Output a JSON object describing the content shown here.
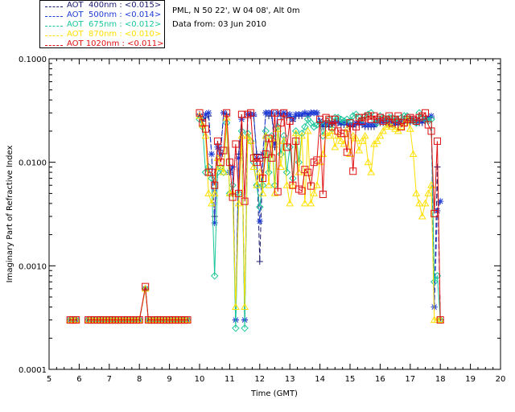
{
  "header": {
    "site": "PML, N 50 22', W 04 08', Alt 0m",
    "date": "Data from: 03 Jun 2010"
  },
  "legend": [
    {
      "label": "AOT  400nm : <0.015>",
      "color": "#1a1a6e"
    },
    {
      "label": "AOT  500nm : <0.014>",
      "color": "#1d3bd6"
    },
    {
      "label": "AOT  675nm : <0.012>",
      "color": "#19c79a"
    },
    {
      "label": "AOT  870nm : <0.010>",
      "color": "#ffe000"
    },
    {
      "label": "AOT 1020nm : <0.011>",
      "color": "#e01010"
    }
  ],
  "chart_data": {
    "type": "line",
    "xlabel": "Time (GMT)",
    "ylabel": "Imaginary Part of Refractive Index",
    "xlim": [
      5,
      20
    ],
    "ylim": [
      0.0001,
      0.1
    ],
    "yscale": "log",
    "x_ticks": [
      "5",
      "6",
      "7",
      "8",
      "9",
      "10",
      "11",
      "12",
      "13",
      "14",
      "15",
      "16",
      "17",
      "18",
      "19",
      "20"
    ],
    "y_ticks": [
      "0.0001",
      "0.0010",
      "0.0100",
      "0.1000"
    ],
    "x": [
      5.7,
      5.8,
      5.9,
      6.3,
      6.4,
      6.5,
      6.6,
      6.7,
      6.8,
      6.9,
      7.0,
      7.1,
      7.2,
      7.3,
      7.4,
      7.5,
      7.6,
      7.7,
      7.8,
      7.9,
      8.0,
      8.2,
      8.3,
      8.4,
      8.5,
      8.6,
      8.7,
      8.8,
      8.9,
      9.0,
      9.1,
      9.2,
      9.3,
      9.4,
      9.5,
      9.6,
      10.0,
      10.1,
      10.2,
      10.3,
      10.4,
      10.5,
      10.6,
      10.7,
      10.8,
      10.9,
      11.0,
      11.1,
      11.2,
      11.3,
      11.4,
      11.5,
      11.6,
      11.7,
      11.8,
      11.9,
      12.0,
      12.1,
      12.2,
      12.3,
      12.4,
      12.5,
      12.6,
      12.7,
      12.8,
      12.9,
      13.0,
      13.1,
      13.2,
      13.3,
      13.4,
      13.5,
      13.6,
      13.7,
      13.8,
      13.9,
      14.0,
      14.1,
      14.2,
      14.3,
      14.4,
      14.5,
      14.6,
      14.7,
      14.8,
      14.9,
      15.0,
      15.1,
      15.2,
      15.3,
      15.4,
      15.5,
      15.6,
      15.7,
      15.8,
      15.9,
      16.0,
      16.1,
      16.2,
      16.3,
      16.4,
      16.5,
      16.6,
      16.7,
      16.8,
      16.9,
      17.0,
      17.1,
      17.2,
      17.3,
      17.4,
      17.5,
      17.6,
      17.7,
      17.8,
      17.9,
      18.0
    ],
    "series": [
      {
        "name": "AOT  400nm : <0.015>",
        "marker": "plus",
        "color": "#1a1a6e",
        "values": [
          0.0003,
          0.0003,
          0.0003,
          0.0003,
          0.0003,
          0.0003,
          0.0003,
          0.0003,
          0.0003,
          0.0003,
          0.0003,
          0.0003,
          0.0003,
          0.0003,
          0.0003,
          0.0003,
          0.0003,
          0.0003,
          0.0003,
          0.0003,
          0.0003,
          0.0006,
          0.0003,
          0.0003,
          0.0003,
          0.0003,
          0.0003,
          0.0003,
          0.0003,
          0.0003,
          0.0003,
          0.0003,
          0.0003,
          0.0003,
          0.0003,
          0.0003,
          0.029,
          0.025,
          0.027,
          0.028,
          0.012,
          0.003,
          0.015,
          0.013,
          0.03,
          0.029,
          0.008,
          0.009,
          0.0003,
          0.012,
          0.027,
          0.0003,
          0.029,
          0.028,
          0.028,
          0.012,
          0.0011,
          0.011,
          0.03,
          0.028,
          0.028,
          0.014,
          0.03,
          0.028,
          0.028,
          0.027,
          0.027,
          0.025,
          0.028,
          0.028,
          0.028,
          0.03,
          0.028,
          0.03,
          0.03,
          0.03,
          0.024,
          0.022,
          0.023,
          0.022,
          0.023,
          0.024,
          0.024,
          0.023,
          0.023,
          0.023,
          0.022,
          0.022,
          0.023,
          0.023,
          0.023,
          0.022,
          0.022,
          0.022,
          0.022,
          0.024,
          0.024,
          0.024,
          0.024,
          0.023,
          0.023,
          0.023,
          0.023,
          0.024,
          0.024,
          0.024,
          0.024,
          0.025,
          0.024,
          0.024,
          0.024,
          0.025,
          0.026,
          0.027,
          0.0004,
          0.009,
          0.0003
        ]
      },
      {
        "name": "AOT  500nm : <0.014>",
        "marker": "asterisk",
        "color": "#1d3bd6",
        "values": [
          0.0003,
          0.0003,
          0.0003,
          0.0003,
          0.0003,
          0.0003,
          0.0003,
          0.0003,
          0.0003,
          0.0003,
          0.0003,
          0.0003,
          0.0003,
          0.0003,
          0.0003,
          0.0003,
          0.0003,
          0.0003,
          0.0003,
          0.0003,
          0.0003,
          0.0006,
          0.0003,
          0.0003,
          0.0003,
          0.0003,
          0.0003,
          0.0003,
          0.0003,
          0.0003,
          0.0003,
          0.0003,
          0.0003,
          0.0003,
          0.0003,
          0.0003,
          0.028,
          0.027,
          0.029,
          0.03,
          0.012,
          0.0026,
          0.014,
          0.012,
          0.03,
          0.028,
          0.008,
          0.009,
          0.0003,
          0.011,
          0.026,
          0.0003,
          0.029,
          0.029,
          0.029,
          0.011,
          0.0027,
          0.012,
          0.03,
          0.03,
          0.03,
          0.015,
          0.03,
          0.029,
          0.03,
          0.029,
          0.029,
          0.026,
          0.029,
          0.029,
          0.029,
          0.03,
          0.029,
          0.03,
          0.03,
          0.03,
          0.025,
          0.023,
          0.024,
          0.024,
          0.024,
          0.025,
          0.025,
          0.024,
          0.024,
          0.024,
          0.023,
          0.023,
          0.024,
          0.024,
          0.024,
          0.023,
          0.023,
          0.023,
          0.023,
          0.025,
          0.025,
          0.025,
          0.025,
          0.024,
          0.024,
          0.024,
          0.024,
          0.025,
          0.025,
          0.025,
          0.026,
          0.026,
          0.025,
          0.025,
          0.025,
          0.026,
          0.027,
          0.028,
          0.0004,
          0.0034,
          0.0042
        ]
      },
      {
        "name": "AOT  675nm : <0.012>",
        "marker": "diamond",
        "color": "#19c79a",
        "values": [
          0.0003,
          0.0003,
          0.0003,
          0.0003,
          0.0003,
          0.0003,
          0.0003,
          0.0003,
          0.0003,
          0.0003,
          0.0003,
          0.0003,
          0.0003,
          0.0003,
          0.0003,
          0.0003,
          0.0003,
          0.0003,
          0.0003,
          0.0003,
          0.0003,
          0.0006,
          0.0003,
          0.0003,
          0.0003,
          0.0003,
          0.0003,
          0.0003,
          0.0003,
          0.0003,
          0.0003,
          0.0003,
          0.0003,
          0.0003,
          0.0003,
          0.0003,
          0.026,
          0.022,
          0.008,
          0.009,
          0.007,
          0.0008,
          0.008,
          0.009,
          0.008,
          0.024,
          0.005,
          0.006,
          0.00025,
          0.005,
          0.02,
          0.00025,
          0.019,
          0.016,
          0.01,
          0.006,
          0.0037,
          0.006,
          0.02,
          0.008,
          0.018,
          0.006,
          0.022,
          0.012,
          0.018,
          0.008,
          0.014,
          0.007,
          0.02,
          0.01,
          0.019,
          0.022,
          0.026,
          0.024,
          0.022,
          0.023,
          0.024,
          0.018,
          0.024,
          0.026,
          0.021,
          0.027,
          0.027,
          0.026,
          0.025,
          0.026,
          0.025,
          0.028,
          0.029,
          0.027,
          0.026,
          0.028,
          0.029,
          0.03,
          0.026,
          0.024,
          0.028,
          0.027,
          0.026,
          0.027,
          0.027,
          0.026,
          0.025,
          0.027,
          0.028,
          0.028,
          0.026,
          0.025,
          0.024,
          0.03,
          0.027,
          0.026,
          0.025,
          0.026,
          0.0007,
          0.0008,
          0.0003
        ]
      },
      {
        "name": "AOT  870nm : <0.010>",
        "marker": "triangle",
        "color": "#ffe000",
        "values": [
          0.0003,
          0.0003,
          0.0003,
          0.0003,
          0.0003,
          0.0003,
          0.0003,
          0.0003,
          0.0003,
          0.0003,
          0.0003,
          0.0003,
          0.0003,
          0.0003,
          0.0003,
          0.0003,
          0.0003,
          0.0003,
          0.0003,
          0.0003,
          0.0003,
          0.0006,
          0.0003,
          0.0003,
          0.0003,
          0.0003,
          0.0003,
          0.0003,
          0.0003,
          0.0003,
          0.0003,
          0.0003,
          0.0003,
          0.0003,
          0.0003,
          0.0003,
          0.028,
          0.023,
          0.018,
          0.005,
          0.004,
          0.005,
          0.011,
          0.009,
          0.008,
          0.027,
          0.005,
          0.005,
          0.0004,
          0.004,
          0.018,
          0.0004,
          0.018,
          0.016,
          0.009,
          0.006,
          0.008,
          0.005,
          0.018,
          0.006,
          0.017,
          0.005,
          0.021,
          0.009,
          0.016,
          0.006,
          0.004,
          0.006,
          0.019,
          0.008,
          0.018,
          0.004,
          0.02,
          0.004,
          0.005,
          0.006,
          0.01,
          0.012,
          0.019,
          0.018,
          0.02,
          0.014,
          0.018,
          0.016,
          0.015,
          0.021,
          0.012,
          0.018,
          0.017,
          0.013,
          0.016,
          0.018,
          0.01,
          0.008,
          0.015,
          0.016,
          0.018,
          0.02,
          0.022,
          0.023,
          0.022,
          0.021,
          0.02,
          0.022,
          0.024,
          0.026,
          0.021,
          0.012,
          0.005,
          0.004,
          0.003,
          0.004,
          0.005,
          0.006,
          0.0003,
          0.0003,
          0.0003
        ]
      },
      {
        "name": "AOT 1020nm : <0.011>",
        "marker": "square",
        "color": "#e01010",
        "values": [
          0.0003,
          0.0003,
          0.0003,
          0.0003,
          0.0003,
          0.0003,
          0.0003,
          0.0003,
          0.0003,
          0.0003,
          0.0003,
          0.0003,
          0.0003,
          0.0003,
          0.0003,
          0.0003,
          0.0003,
          0.0003,
          0.0003,
          0.0003,
          0.0003,
          0.00063,
          0.0003,
          0.0003,
          0.0003,
          0.0003,
          0.0003,
          0.0003,
          0.0003,
          0.0003,
          0.0003,
          0.0003,
          0.0003,
          0.0003,
          0.0003,
          0.0003,
          0.03,
          0.024,
          0.021,
          0.008,
          0.008,
          0.006,
          0.016,
          0.01,
          0.013,
          0.03,
          0.01,
          0.0046,
          0.015,
          0.005,
          0.029,
          0.0042,
          0.029,
          0.03,
          0.011,
          0.01,
          0.011,
          0.007,
          0.012,
          0.017,
          0.011,
          0.03,
          0.0052,
          0.024,
          0.03,
          0.014,
          0.025,
          0.006,
          0.016,
          0.0055,
          0.0053,
          0.0085,
          0.008,
          0.0059,
          0.01,
          0.0105,
          0.026,
          0.0049,
          0.027,
          0.026,
          0.022,
          0.026,
          0.02,
          0.019,
          0.019,
          0.0125,
          0.024,
          0.0082,
          0.022,
          0.027,
          0.025,
          0.027,
          0.028,
          0.026,
          0.028,
          0.026,
          0.027,
          0.025,
          0.026,
          0.028,
          0.024,
          0.026,
          0.028,
          0.022,
          0.024,
          0.026,
          0.027,
          0.026,
          0.025,
          0.027,
          0.028,
          0.03,
          0.023,
          0.02,
          0.0032,
          0.016,
          0.0003
        ]
      }
    ]
  }
}
